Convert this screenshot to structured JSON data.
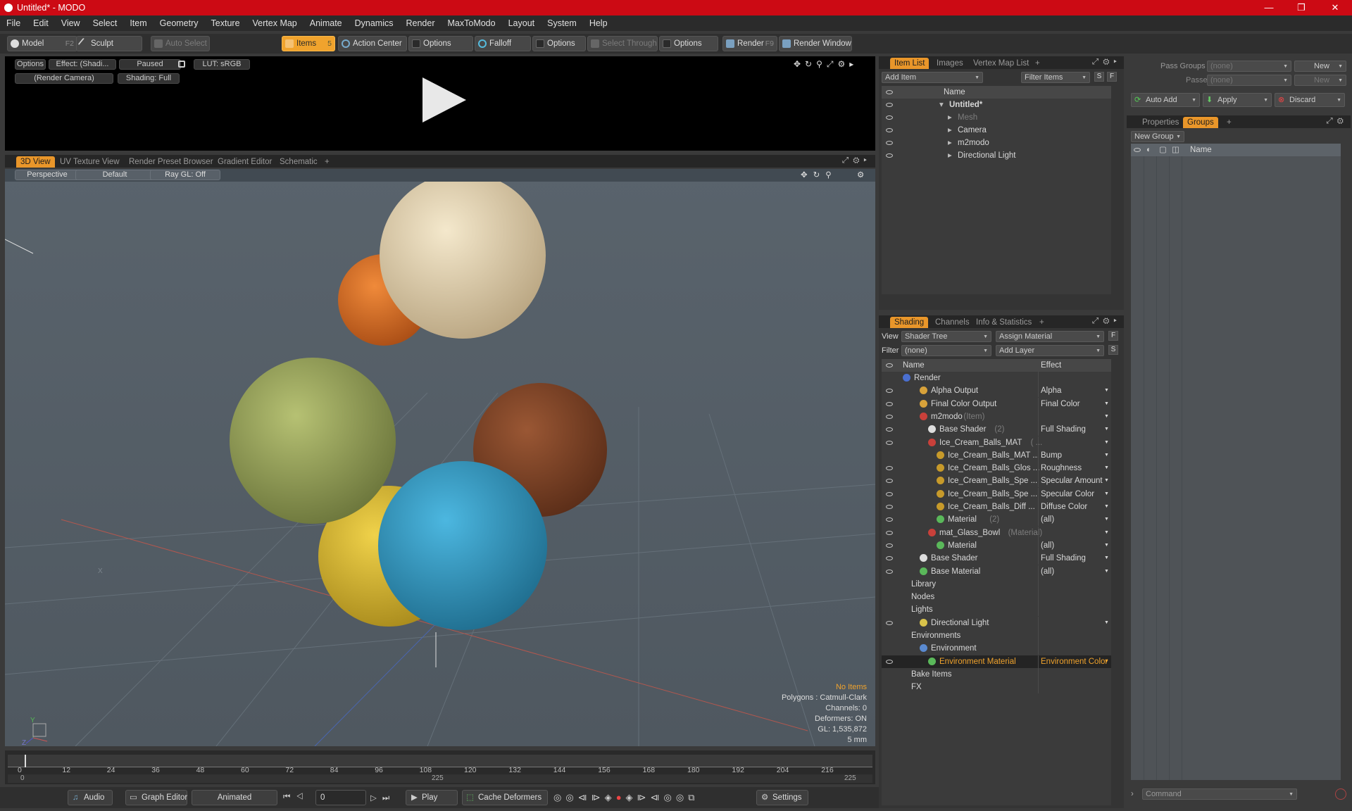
{
  "window": {
    "title": "Untitled* - MODO",
    "min": "—",
    "max": "❐",
    "close": "✕"
  },
  "menu": [
    "File",
    "Edit",
    "View",
    "Select",
    "Item",
    "Geometry",
    "Texture",
    "Vertex Map",
    "Animate",
    "Dynamics",
    "Render",
    "MaxToModo",
    "Layout",
    "System",
    "Help"
  ],
  "toolbar": {
    "model": "Model",
    "model_key": "F2",
    "sculpt": "Sculpt",
    "auto_select": "Auto Select",
    "items": "Items",
    "items_key": "5",
    "action_center": "Action Center",
    "options1": "Options",
    "falloff": "Falloff",
    "options2": "Options",
    "select_through": "Select Through",
    "options3": "Options",
    "render": "Render",
    "render_key": "F9",
    "render_window": "Render Window"
  },
  "render_preview": {
    "options": "Options",
    "effect": "Effect: (Shadi...",
    "paused": "Paused",
    "lut": "LUT: sRGB",
    "camera": "(Render Camera)",
    "shading": "Shading: Full"
  },
  "viewport_tabs": [
    "3D View",
    "UV Texture View",
    "Render Preset Browser",
    "Gradient Editor",
    "Schematic"
  ],
  "viewport": {
    "perspective": "Perspective",
    "default": "Default",
    "raygl": "Ray GL: Off",
    "no_items": "No Items",
    "stats": [
      "Polygons : Catmull-Clark",
      "Channels: 0",
      "Deformers: ON",
      "GL: 1,535,872",
      "5 mm"
    ],
    "axis_x": "X",
    "axis_y": "Y",
    "axis_z": "Z"
  },
  "scoops": [
    {
      "color": "#e8d7b2",
      "name": "vanilla"
    },
    {
      "color": "#a2ad62",
      "name": "pistachio"
    },
    {
      "color": "#37a1c9",
      "name": "blue"
    },
    {
      "color": "#e6c53a",
      "name": "yellow"
    },
    {
      "color": "#86482a",
      "name": "chocolate"
    },
    {
      "color": "#e3742a",
      "name": "orange"
    }
  ],
  "timeline": {
    "ticks": [
      "0",
      "12",
      "24",
      "36",
      "48",
      "60",
      "72",
      "84",
      "96",
      "108",
      "120",
      "132",
      "144",
      "156",
      "168",
      "180",
      "192",
      "204",
      "216"
    ],
    "start": "0",
    "mid": "225",
    "end": "225"
  },
  "bottom": {
    "audio": "Audio",
    "graph_editor": "Graph Editor",
    "animated": "Animated",
    "frame": "0",
    "play": "Play",
    "cache": "Cache Deformers",
    "settings": "Settings"
  },
  "item_list": {
    "tabs": [
      "Item List",
      "Images",
      "Vertex Map List"
    ],
    "add_item": "Add Item",
    "filter_items": "Filter Items",
    "s": "S",
    "f": "F",
    "name_col": "Name",
    "rows": [
      {
        "label": "Untitled*",
        "bold": true,
        "indent": 0
      },
      {
        "label": "Mesh",
        "dim": true,
        "indent": 1
      },
      {
        "label": "Camera",
        "indent": 1
      },
      {
        "label": "m2modo",
        "indent": 1
      },
      {
        "label": "Directional Light",
        "indent": 1
      }
    ]
  },
  "shading": {
    "tabs": [
      "Shading",
      "Channels",
      "Info & Statistics"
    ],
    "view_label": "View",
    "view_value": "Shader Tree",
    "assign_material": "Assign Material",
    "f": "F",
    "filter_label": "Filter",
    "filter_value": "(none)",
    "add_layer": "Add Layer",
    "s": "S",
    "name_col": "Name",
    "effect_col": "Effect",
    "rows": [
      {
        "label": "Render",
        "effect": "",
        "indent": 0,
        "icon": "#4a6fd0",
        "eye": false
      },
      {
        "label": "Alpha Output",
        "effect": "Alpha",
        "indent": 2,
        "icon": "#d8a23a",
        "eye": true
      },
      {
        "label": "Final Color Output",
        "effect": "Final Color",
        "indent": 2,
        "icon": "#d8a23a",
        "eye": true
      },
      {
        "label": "m2modo",
        "suffix": "(Item)",
        "effect": "",
        "indent": 2,
        "icon": "#c8403a",
        "eye": true
      },
      {
        "label": "Base Shader",
        "suffix": "(2)",
        "effect": "Full Shading",
        "indent": 3,
        "icon": "#dddddd",
        "eye": true
      },
      {
        "label": "Ice_Cream_Balls_MAT",
        "suffix": "( ...",
        "effect": "",
        "indent": 3,
        "icon": "#c8403a",
        "eye": true
      },
      {
        "label": "Ice_Cream_Balls_MAT ...",
        "effect": "Bump",
        "indent": 4,
        "icon": "#c79a2a",
        "eye": false
      },
      {
        "label": "Ice_Cream_Balls_Glos ...",
        "effect": "Roughness",
        "indent": 4,
        "icon": "#c79a2a",
        "eye": true
      },
      {
        "label": "Ice_Cream_Balls_Spe ...",
        "effect": "Specular Amount",
        "indent": 4,
        "icon": "#c79a2a",
        "eye": true
      },
      {
        "label": "Ice_Cream_Balls_Spe ...",
        "effect": "Specular Color",
        "indent": 4,
        "icon": "#c79a2a",
        "eye": true
      },
      {
        "label": "Ice_Cream_Balls_Diff ...",
        "effect": "Diffuse Color",
        "indent": 4,
        "icon": "#c79a2a",
        "eye": true
      },
      {
        "label": "Material",
        "suffix": "(2)",
        "effect": "(all)",
        "indent": 4,
        "icon": "#5ab85a",
        "eye": true
      },
      {
        "label": "mat_Glass_Bowl",
        "suffix": "(Material)",
        "effect": "",
        "indent": 3,
        "icon": "#c8403a",
        "eye": true
      },
      {
        "label": "Material",
        "effect": "(all)",
        "indent": 4,
        "icon": "#5ab85a",
        "eye": true
      },
      {
        "label": "Base Shader",
        "effect": "Full Shading",
        "indent": 2,
        "icon": "#dddddd",
        "eye": true
      },
      {
        "label": "Base Material",
        "effect": "(all)",
        "indent": 2,
        "icon": "#5ab85a",
        "eye": true
      },
      {
        "label": "Library",
        "effect": "",
        "indent": 1,
        "icon": "",
        "eye": false
      },
      {
        "label": "Nodes",
        "effect": "",
        "indent": 1,
        "icon": "",
        "eye": false
      },
      {
        "label": "Lights",
        "effect": "",
        "indent": 1,
        "icon": "",
        "eye": false
      },
      {
        "label": "Directional Light",
        "effect": "",
        "indent": 2,
        "icon": "#d8c24a",
        "eye": true
      },
      {
        "label": "Environments",
        "effect": "",
        "indent": 1,
        "icon": "",
        "eye": false
      },
      {
        "label": "Environment",
        "effect": "",
        "indent": 2,
        "icon": "#5a8ad0",
        "eye": false
      },
      {
        "label": "Environment Material",
        "effect": "Environment Color",
        "indent": 3,
        "icon": "#5ab85a",
        "eye": true,
        "selected": true
      },
      {
        "label": "Bake Items",
        "effect": "",
        "indent": 1,
        "icon": "",
        "eye": false
      },
      {
        "label": "FX",
        "effect": "",
        "indent": 1,
        "icon": "",
        "eye": false
      }
    ]
  },
  "groups": {
    "pass_groups": "Pass Groups",
    "passes": "Passes",
    "none1": "(none)",
    "none2": "(none)",
    "new1": "New",
    "new2": "New",
    "auto_add": "Auto Add",
    "apply": "Apply",
    "discard": "Discard",
    "tabs": [
      "Properties",
      "Groups"
    ],
    "new_group": "New Group",
    "name_col": "Name",
    "command": "Command"
  }
}
